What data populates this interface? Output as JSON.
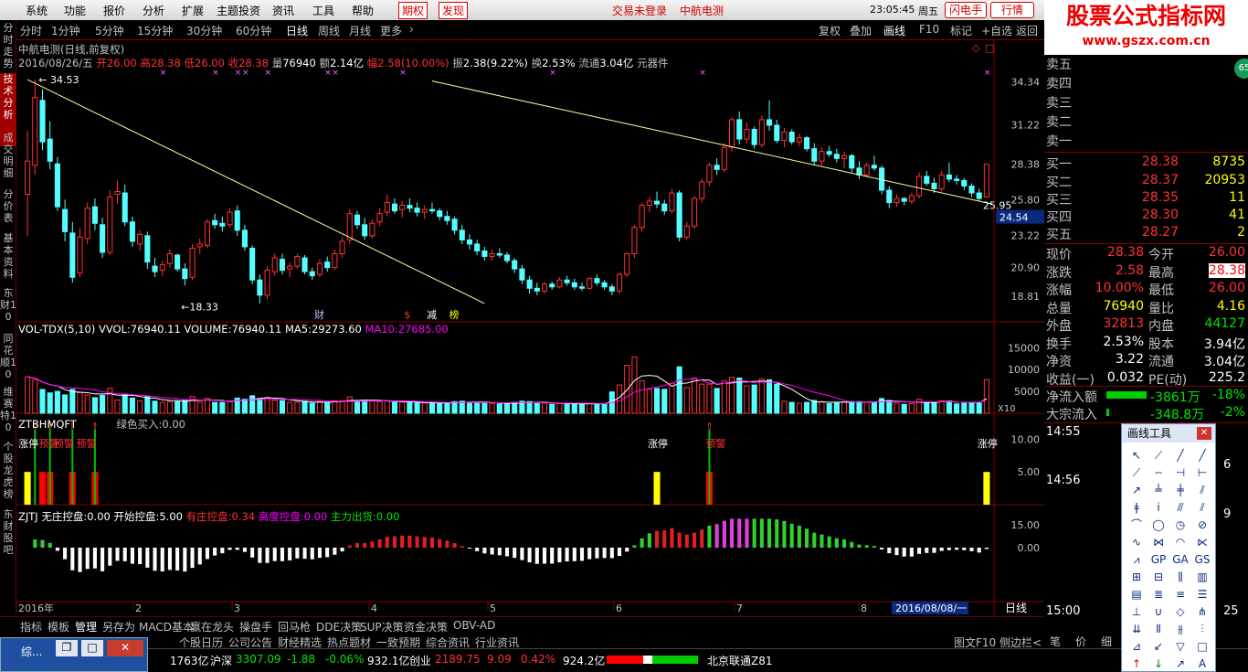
{
  "menubar": {
    "items": [
      "系统",
      "功能",
      "报价",
      "分析",
      "扩展",
      "主题投资",
      "资讯",
      "工具",
      "帮助"
    ],
    "quan": "期权",
    "warn": "发现",
    "login": "交易未登录",
    "stockname": "中航电测",
    "time": "23:05:45",
    "weekday": "周五",
    "flash_btn": "闪电手",
    "quote_btn": "行情"
  },
  "logo": {
    "line1": "股票公式指标网",
    "line2": "www.gszx.com.cn"
  },
  "left_tabs": [
    "分时走势",
    "技术分析",
    "成交明细",
    "分价表",
    "基本资料",
    "东财10",
    "同花顺10",
    "维赛特10",
    "个股龙虎榜",
    "东财股吧"
  ],
  "period_tabs": [
    "分时",
    "1分钟",
    "5分钟",
    "15分钟",
    "30分钟",
    "60分钟",
    "日线",
    "周线",
    "月线",
    "更多"
  ],
  "active_period": "日线",
  "toolbar": [
    "复权",
    "叠加",
    "画线",
    "F10",
    "标记",
    "+自选",
    "返回"
  ],
  "chart_header": {
    "title": "中航电测(日线,前复权)",
    "date": "2016/08/26/五",
    "open_label": "开",
    "open": "26.00",
    "high_label": "高",
    "high": "28.38",
    "low_label": "低",
    "low": "26.00",
    "close_label": "收",
    "close": "28.38",
    "vol_label": "量",
    "vol": "76940",
    "amount_label": "额",
    "amount": "2.14亿",
    "range_label": "幅",
    "range": "2.58(10.00%)",
    "amp_label": "振",
    "amp": "2.38(9.22%)",
    "turn_label": "换",
    "turn": "2.53%",
    "float_label": "流通",
    "float": "3.04亿",
    "sector": "元器件"
  },
  "chart_data": {
    "type": "candlestick",
    "price_axis": {
      "ticks": [
        34.34,
        31.22,
        28.38,
        25.8,
        23.22,
        20.9,
        18.81
      ],
      "range": [
        17.5,
        35.5
      ]
    },
    "current_price_marker": "24.54",
    "high_note": "34.53",
    "low_note": "18.33",
    "right_note": "25.95",
    "ohlc": [
      [
        26.2,
        30.8,
        23.2,
        28.6
      ],
      [
        28.3,
        34.5,
        27.6,
        33.2
      ],
      [
        33.0,
        33.8,
        29.4,
        30.0
      ],
      [
        30.2,
        31.5,
        28.0,
        28.6
      ],
      [
        28.4,
        28.9,
        25.0,
        25.3
      ],
      [
        25.1,
        25.8,
        22.8,
        23.5
      ],
      [
        23.4,
        24.2,
        19.8,
        20.2
      ],
      [
        20.5,
        23.8,
        20.2,
        23.1
      ],
      [
        23.0,
        25.6,
        22.6,
        25.2
      ],
      [
        25.3,
        25.9,
        23.6,
        24.1
      ],
      [
        24.0,
        24.5,
        21.6,
        22.0
      ],
      [
        22.0,
        26.5,
        21.8,
        26.0
      ],
      [
        26.2,
        27.2,
        25.5,
        26.4
      ],
      [
        26.3,
        26.9,
        23.9,
        24.2
      ],
      [
        24.2,
        24.6,
        22.4,
        22.8
      ],
      [
        22.6,
        23.6,
        22.1,
        23.3
      ],
      [
        23.2,
        23.5,
        20.8,
        21.3
      ],
      [
        21.0,
        21.6,
        20.2,
        20.6
      ],
      [
        20.7,
        21.4,
        20.3,
        21.1
      ],
      [
        21.2,
        22.2,
        20.9,
        21.9
      ],
      [
        21.8,
        21.9,
        20.6,
        20.8
      ],
      [
        20.8,
        21.2,
        19.6,
        20.1
      ],
      [
        20.2,
        22.6,
        20.0,
        22.3
      ],
      [
        22.4,
        23.0,
        21.9,
        22.6
      ],
      [
        22.5,
        24.4,
        22.3,
        24.2
      ],
      [
        24.3,
        24.8,
        23.7,
        24.0
      ],
      [
        24.1,
        24.6,
        23.5,
        23.9
      ],
      [
        24.0,
        25.2,
        23.8,
        24.9
      ],
      [
        25.0,
        25.4,
        23.2,
        23.6
      ],
      [
        23.6,
        24.0,
        22.1,
        22.4
      ],
      [
        22.3,
        22.5,
        19.7,
        20.0
      ],
      [
        20.0,
        20.4,
        18.3,
        18.9
      ],
      [
        18.9,
        21.0,
        18.6,
        20.7
      ],
      [
        20.6,
        21.9,
        20.3,
        21.6
      ],
      [
        21.5,
        21.9,
        20.4,
        20.7
      ],
      [
        20.8,
        21.3,
        20.2,
        21.0
      ],
      [
        21.0,
        21.9,
        20.8,
        21.7
      ],
      [
        21.6,
        21.8,
        20.4,
        20.6
      ],
      [
        20.6,
        20.9,
        20.0,
        20.3
      ],
      [
        20.4,
        21.5,
        20.2,
        21.2
      ],
      [
        21.3,
        21.7,
        20.6,
        20.9
      ],
      [
        20.9,
        22.2,
        20.7,
        21.9
      ],
      [
        21.9,
        23.1,
        21.6,
        22.8
      ],
      [
        22.9,
        25.1,
        22.6,
        24.8
      ],
      [
        24.7,
        25.0,
        23.7,
        24.0
      ],
      [
        24.0,
        24.5,
        22.9,
        23.2
      ],
      [
        23.2,
        24.4,
        23.0,
        24.1
      ],
      [
        24.2,
        25.2,
        23.9,
        24.8
      ],
      [
        24.9,
        26.2,
        24.6,
        25.6
      ],
      [
        25.5,
        25.9,
        24.8,
        25.0
      ],
      [
        25.1,
        25.7,
        24.5,
        25.4
      ],
      [
        25.4,
        25.9,
        24.9,
        25.2
      ],
      [
        25.2,
        25.6,
        24.6,
        24.9
      ],
      [
        24.9,
        25.4,
        24.4,
        25.1
      ],
      [
        25.1,
        25.6,
        24.8,
        25.0
      ],
      [
        25.0,
        25.2,
        24.3,
        24.6
      ],
      [
        24.6,
        25.0,
        24.0,
        24.3
      ],
      [
        24.4,
        24.6,
        23.3,
        23.6
      ],
      [
        23.6,
        24.0,
        22.6,
        22.9
      ],
      [
        22.9,
        23.3,
        22.2,
        22.6
      ],
      [
        22.6,
        22.9,
        21.8,
        22.1
      ],
      [
        22.1,
        22.4,
        21.4,
        21.7
      ],
      [
        21.7,
        22.2,
        21.4,
        21.9
      ],
      [
        21.9,
        22.3,
        21.6,
        21.8
      ],
      [
        21.8,
        22.0,
        21.2,
        21.4
      ],
      [
        21.4,
        21.6,
        20.5,
        20.8
      ],
      [
        20.8,
        21.1,
        19.7,
        20.0
      ],
      [
        20.0,
        20.3,
        19.0,
        19.4
      ],
      [
        19.4,
        19.8,
        18.9,
        19.2
      ],
      [
        19.2,
        19.9,
        19.0,
        19.7
      ],
      [
        19.7,
        19.9,
        19.3,
        19.5
      ],
      [
        19.5,
        20.2,
        19.4,
        20.0
      ],
      [
        20.0,
        20.3,
        19.6,
        19.8
      ],
      [
        19.8,
        20.1,
        19.3,
        19.5
      ],
      [
        19.5,
        19.8,
        19.2,
        19.4
      ],
      [
        19.4,
        20.2,
        19.3,
        20.1
      ],
      [
        20.1,
        20.4,
        19.6,
        19.8
      ],
      [
        19.8,
        20.0,
        19.3,
        19.5
      ],
      [
        19.5,
        19.7,
        18.9,
        19.2
      ],
      [
        19.2,
        20.6,
        19.0,
        20.4
      ],
      [
        20.4,
        22.0,
        20.2,
        21.9
      ],
      [
        21.9,
        24.0,
        21.6,
        23.8
      ],
      [
        23.8,
        25.6,
        23.5,
        25.4
      ],
      [
        25.4,
        26.0,
        24.9,
        25.7
      ],
      [
        25.7,
        26.4,
        25.2,
        25.5
      ],
      [
        25.5,
        25.8,
        24.7,
        25.0
      ],
      [
        25.0,
        26.6,
        24.8,
        26.3
      ],
      [
        26.3,
        26.5,
        22.8,
        23.1
      ],
      [
        23.1,
        24.2,
        22.9,
        23.9
      ],
      [
        23.9,
        26.1,
        23.7,
        25.9
      ],
      [
        25.9,
        27.3,
        25.6,
        27.1
      ],
      [
        27.1,
        28.5,
        26.8,
        28.3
      ],
      [
        28.3,
        28.8,
        27.6,
        28.0
      ],
      [
        28.0,
        29.9,
        27.8,
        29.6
      ],
      [
        29.6,
        31.8,
        29.3,
        31.6
      ],
      [
        31.6,
        32.2,
        29.8,
        30.2
      ],
      [
        30.2,
        31.4,
        29.9,
        30.9
      ],
      [
        30.9,
        31.1,
        29.5,
        29.8
      ],
      [
        29.8,
        31.9,
        29.6,
        31.6
      ],
      [
        31.6,
        33.0,
        30.8,
        31.2
      ],
      [
        31.2,
        31.6,
        29.9,
        30.1
      ],
      [
        30.1,
        31.0,
        29.6,
        30.7
      ],
      [
        30.7,
        30.9,
        29.8,
        30.0
      ],
      [
        30.0,
        30.6,
        29.7,
        30.3
      ],
      [
        30.3,
        30.4,
        29.3,
        29.5
      ],
      [
        29.5,
        29.9,
        28.3,
        28.6
      ],
      [
        28.6,
        29.6,
        28.3,
        29.3
      ],
      [
        29.3,
        29.7,
        28.9,
        29.1
      ],
      [
        29.1,
        29.5,
        28.5,
        28.8
      ],
      [
        28.8,
        29.3,
        28.1,
        29.0
      ],
      [
        29.0,
        29.1,
        27.8,
        28.1
      ],
      [
        28.1,
        28.6,
        27.3,
        27.6
      ],
      [
        27.6,
        28.5,
        27.4,
        28.3
      ],
      [
        28.3,
        29.0,
        27.9,
        28.1
      ],
      [
        28.1,
        28.3,
        26.2,
        26.5
      ],
      [
        26.5,
        26.8,
        25.2,
        25.6
      ],
      [
        25.6,
        26.2,
        25.3,
        25.9
      ],
      [
        25.9,
        26.0,
        25.4,
        25.7
      ],
      [
        25.7,
        26.3,
        25.5,
        26.1
      ],
      [
        26.1,
        27.8,
        25.9,
        27.5
      ],
      [
        27.5,
        27.9,
        26.8,
        27.0
      ],
      [
        27.0,
        27.4,
        26.3,
        26.6
      ],
      [
        26.6,
        27.9,
        26.4,
        27.6
      ],
      [
        27.6,
        28.5,
        27.1,
        27.3
      ],
      [
        27.3,
        27.6,
        26.9,
        27.2
      ],
      [
        27.2,
        27.4,
        26.5,
        26.8
      ],
      [
        26.8,
        27.0,
        26.0,
        26.3
      ],
      [
        26.3,
        26.6,
        25.7,
        25.9
      ],
      [
        26.0,
        28.4,
        26.0,
        28.38
      ]
    ],
    "volume": {
      "header": "VOL-TDX(5,10)",
      "vvol_label": "VVOL:",
      "vvol": "76940.11",
      "volume_label": "VOLUME:",
      "volume_val": "76940.11",
      "ma5_label": "MA5:",
      "ma5": "29273.60",
      "ma10_label": "MA10:",
      "ma10": "27685.00",
      "ticks": [
        15000,
        10000,
        5000
      ],
      "unit": "X10",
      "range": [
        0,
        18000
      ]
    },
    "indicator2": {
      "name": "ZTBHMQFT",
      "green_label": "绿色买入:",
      "green_val": "0.00",
      "ticks": [
        10.0,
        5.0
      ],
      "limit_up_label": "涨停",
      "warn_label": "预警"
    },
    "indicator3": {
      "name": "ZJTJ",
      "l1": "无庄控盘:",
      "v1": "0.00",
      "l2": "开始控盘:",
      "v2": "5.00",
      "l3": "有庄控盘:",
      "v3": "0.34",
      "l4": "高度控盘:",
      "v4": "0.00",
      "l5": "主力出货:",
      "v5": "0.00",
      "ticks": [
        15.0,
        0.0
      ]
    },
    "date_axis": [
      "2016年",
      "2",
      "3",
      "4",
      "5",
      "6",
      "7",
      "8"
    ],
    "date_selected": "2016/08/08/一",
    "period_label": "日线",
    "event_marks": [
      "财",
      "$",
      "减",
      "榜"
    ]
  },
  "bottom_tabs": [
    "指标",
    "模板",
    "管理",
    "另存为",
    "MACD基本",
    "赢在龙头",
    "操盘手",
    "回马枪",
    "DDE决策",
    "SUP决策",
    "资金决策",
    "OBV-AD"
  ],
  "bottom_tabs2": [
    "个股日历",
    "公司公告",
    "财经精选",
    "热点题材",
    "一致预期",
    "综合资讯",
    "行业资讯"
  ],
  "right_panel": {
    "sell_labels": [
      "卖五",
      "卖四",
      "卖三",
      "卖二",
      "卖一"
    ],
    "buy": [
      {
        "label": "买一",
        "price": "28.38",
        "vol": "8735"
      },
      {
        "label": "买二",
        "price": "28.37",
        "vol": "20953"
      },
      {
        "label": "买三",
        "price": "28.35",
        "vol": "11"
      },
      {
        "label": "买四",
        "price": "28.30",
        "vol": "41"
      },
      {
        "label": "买五",
        "price": "28.27",
        "vol": "2"
      }
    ],
    "stats": [
      {
        "l1": "现价",
        "v1": "28.38",
        "l2": "今开",
        "v2": "26.00"
      },
      {
        "l1": "涨跌",
        "v1": "2.58",
        "l2": "最高",
        "v2": "28.38"
      },
      {
        "l1": "涨幅",
        "v1": "10.00%",
        "l2": "最低",
        "v2": "26.00"
      },
      {
        "l1": "总量",
        "v1": "76940",
        "l2": "量比",
        "v2": "4.16"
      },
      {
        "l1": "外盘",
        "v1": "32813",
        "l2": "内盘",
        "v2": "44127"
      },
      {
        "l1": "换手",
        "v1": "2.53%",
        "l2": "股本",
        "v2": "3.94亿"
      },
      {
        "l1": "净资",
        "v1": "3.22",
        "l2": "流通",
        "v2": "3.04亿"
      },
      {
        "l1": "收益(一)",
        "v1": "0.032",
        "l2": "PE(动)",
        "v2": "225.2"
      }
    ],
    "flow1_label": "净流入额",
    "flow1_val": "-3861万",
    "flow1_pct": "-18%",
    "flow2_label": "大宗流入",
    "flow2_val": "-348.8万",
    "flow2_pct": "-2%",
    "times": [
      "14:55",
      "14:56",
      "15:00"
    ],
    "tick_vals": [
      "6",
      "9",
      "25"
    ],
    "badge": "65",
    "bottom_labels": [
      "笔",
      "价",
      "细"
    ]
  },
  "draw_tools": {
    "title": "画线工具"
  },
  "statusbar": {
    "window_title": "综...",
    "amt1": "1763亿",
    "sh_label": "沪深",
    "sh_val": "3307.09",
    "sh_chg": "-1.88",
    "sh_pct": "-0.06%",
    "sh_amt": "932.1亿",
    "cy_label": "创业",
    "cy_val": "2189.75",
    "cy_chg": "9.09",
    "cy_pct": "0.42%",
    "cy_amt": "924.2亿",
    "server": "北京联通Z81",
    "f10": "图文F10",
    "side": "侧边栏<"
  }
}
